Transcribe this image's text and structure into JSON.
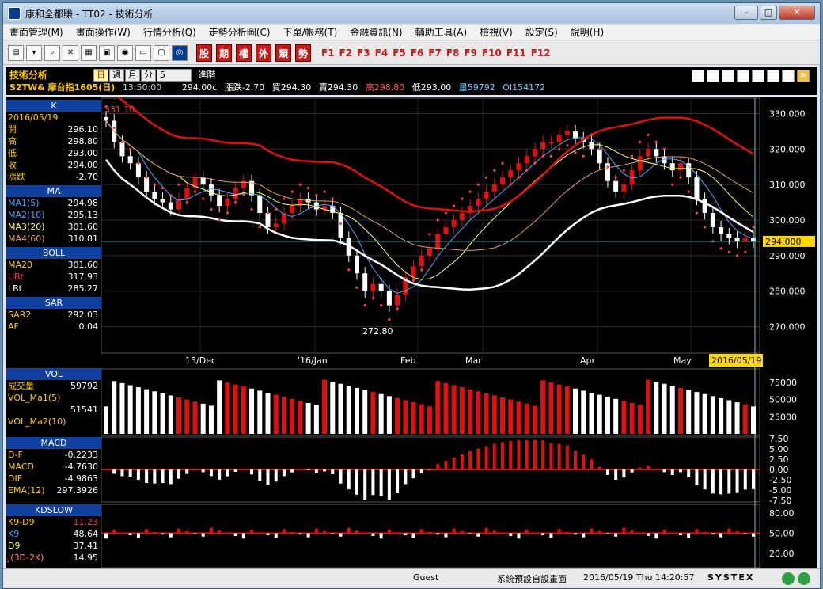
{
  "window": {
    "title": "康和全都賺 - TT02 - 技術分析"
  },
  "menu": [
    "畫面管理(M)",
    "畫面操作(W)",
    "行情分析(Q)",
    "走勢分析圖(C)",
    "下單/帳務(T)",
    "金融資訊(N)",
    "輔助工具(A)",
    "檢視(V)",
    "設定(S)",
    "說明(H)"
  ],
  "toolbar": {
    "red_buttons": [
      "股",
      "期",
      "權",
      "外",
      "類",
      "勢"
    ],
    "fkeys": [
      "F1",
      "F2",
      "F3",
      "F4",
      "F5",
      "F6",
      "F7",
      "F8",
      "F9",
      "F10",
      "F11",
      "F12"
    ]
  },
  "info": {
    "title": "技術分析",
    "periods": [
      "日",
      "週",
      "月",
      "分"
    ],
    "period_count": "5",
    "mode": "進階",
    "symbol": "S2TW& 摩台指1605(日)",
    "time": "13:50:00",
    "last": "294.00c",
    "change": "漲跌-2.70",
    "bid": "買294.30",
    "ask": "賣294.30",
    "high": "高298.80",
    "low": "低293.00",
    "volume": "量59792",
    "oi": "OI154172"
  },
  "left": {
    "k_head": "K",
    "date": "2016/05/19",
    "k_rows": [
      {
        "label": "開",
        "value": "296.10"
      },
      {
        "label": "高",
        "value": "298.80"
      },
      {
        "label": "低",
        "value": "293.00"
      },
      {
        "label": "收",
        "value": "294.00"
      },
      {
        "label": "漲跌",
        "value": "-2.70"
      }
    ],
    "ma_head": "MA",
    "ma_rows": [
      {
        "label": "MA1(5)",
        "value": "294.98"
      },
      {
        "label": "MA2(10)",
        "value": "295.13"
      },
      {
        "label": "MA3(20)",
        "value": "301.60"
      },
      {
        "label": "MA4(60)",
        "value": "310.81"
      }
    ],
    "boll_head": "BOLL",
    "boll_rows": [
      {
        "label": "MA20",
        "value": "301.60"
      },
      {
        "label": "UBt",
        "value": "317.93"
      },
      {
        "label": "LBt",
        "value": "285.27"
      }
    ],
    "sar_head": "SAR",
    "sar_rows": [
      {
        "label": "SAR2",
        "value": "292.03"
      },
      {
        "label": "AF",
        "value": "0.04"
      }
    ],
    "vol_head": "VOL",
    "vol_rows": [
      {
        "label": "成交量",
        "value": "59792"
      },
      {
        "label": "VOL_Ma1(5)",
        "value": ""
      },
      {
        "label": "",
        "value": "51541"
      },
      {
        "label": "VOL_Ma2(10)",
        "value": ""
      }
    ],
    "macd_head": "MACD",
    "macd_rows": [
      {
        "label": "D-F",
        "value": "-0.2233"
      },
      {
        "label": "MACD",
        "value": "-4.7630"
      },
      {
        "label": "DIF",
        "value": "-4.9863"
      },
      {
        "label": "EMA(12)",
        "value": "297.3926"
      }
    ],
    "kd_head": "KDSLOW",
    "kd_rows": [
      {
        "label": "K9-D9",
        "value": "11.23"
      },
      {
        "label": "K9",
        "value": "48.64"
      },
      {
        "label": "D9",
        "value": "37.41"
      },
      {
        "label": "J(3D-2K)",
        "value": "14.95"
      }
    ]
  },
  "chart_data": {
    "type": "line",
    "title": "",
    "price_axis": [
      "330.000",
      "320.000",
      "310.000",
      "300.000",
      "290.000",
      "280.000",
      "270.000"
    ],
    "month_labels": [
      "'15/Dec",
      "'16/Jan",
      "Feb",
      "Mar",
      "Apr",
      "May"
    ],
    "max_label": "331.10",
    "min_label": "272.80",
    "current_price": "294.000",
    "cursor_date": "2016/05/19",
    "close": [
      328,
      322,
      318,
      316,
      312,
      308,
      306,
      305,
      303,
      306,
      309,
      312,
      310,
      307,
      304,
      306,
      309,
      311,
      307,
      302,
      298,
      299,
      302,
      304,
      306,
      305,
      303,
      304,
      302,
      295,
      290,
      285,
      280,
      282,
      280,
      276,
      279,
      284,
      287,
      290,
      292,
      296,
      298,
      300,
      302,
      304,
      306,
      308,
      310,
      312,
      314,
      316,
      318,
      320,
      322,
      322,
      324,
      325,
      323,
      322,
      320,
      316,
      311,
      308,
      310,
      314,
      318,
      320,
      318,
      316,
      314,
      316,
      312,
      306,
      302,
      298,
      296,
      295,
      294,
      295,
      294
    ],
    "vol_axis": [
      "75000",
      "50000",
      "25000"
    ],
    "macd_axis": [
      "7.50",
      "5.00",
      "2.50",
      "0.00",
      "-2.50",
      "-5.00",
      "-7.50"
    ],
    "kd_axis": [
      "80.00",
      "50.00",
      "20.00"
    ],
    "colors": {
      "up": "#e01010",
      "down": "#ffffff",
      "boll_upper": "#e01010",
      "boll_lower": "#ffffff",
      "ma5": "#4da3ff",
      "ma10": "#ffff66",
      "ma20": "#e0a060",
      "sar": "#ff4040",
      "grid": "#303030",
      "text": "#ffffff"
    }
  },
  "status": {
    "user": "Guest",
    "layout": "系統預設自設畫面",
    "datetime": "2016/05/19 Thu 14:20:57",
    "brand": "SYSTEX"
  }
}
